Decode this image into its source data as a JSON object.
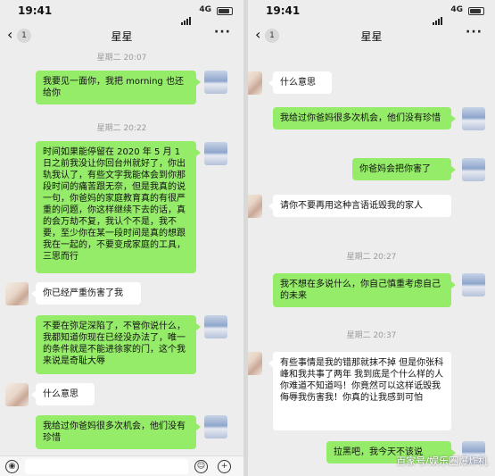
{
  "left": {
    "status_time": "19:41",
    "network": "4G",
    "nav_badge": "1",
    "nav_title": "星星",
    "ts1": "星期二 20:07",
    "msg1": "我要见一面你，我把 morning 也还给你",
    "ts2": "星期二 20:22",
    "msg2": "时间如果能停留在 2020 年 5 月 1 日之前我没让你回台州就好了，你出轨我认了，有些文字我能体会到你那段时间的痛苦跟无奈，但是我真的说一句，你爸妈的家庭教育真的有很严重的问题，你这样继续下去的话，真的会万劫不复，我认个不是，我不要，至少你在某一段时间是真的想跟我在一起的，不要变成家庭的工具，三思而行",
    "msg3": "你已经严重伤害了我",
    "msg4": "不要在弥足深陷了，不管你说什么，我都知道你现在已经没办法了，唯一的条件就是不能进徐家的门，这个我来说是奇耻大辱",
    "msg5": "什么意思",
    "msg6": "我给过你爸妈很多次机会，他们没有珍惜"
  },
  "right": {
    "status_time": "19:41",
    "network": "4G",
    "nav_badge": "1",
    "nav_title": "星星",
    "msg1": "什么意思",
    "msg2": "我给过你爸妈很多次机会，他们没有珍惜",
    "msg3": "你爸妈会把你害了",
    "msg4": "请你不要再用这种言语诋毁我的家人",
    "ts1": "星期二 20:27",
    "msg5": "我不想在多说什么，你自己慎重考虑自己的未来",
    "ts2": "星期二 20:37",
    "msg6": "有些事情是我的错那就抹不掉 但是你张科峰和我共事了两年 我到底是个什么样的人你难道不知道吗！你竟然可以这样诋毁我侮辱我伤害我！你真的让我感到可怕",
    "msg7": "拉黑吧，我今天不该说",
    "watermark": "百家号/娱乐圈爆炸机"
  },
  "icons": [
    "back-arrow-icon",
    "more-icon",
    "voice-icon",
    "emoji-icon",
    "plus-icon",
    "signal-icon",
    "battery-icon"
  ]
}
